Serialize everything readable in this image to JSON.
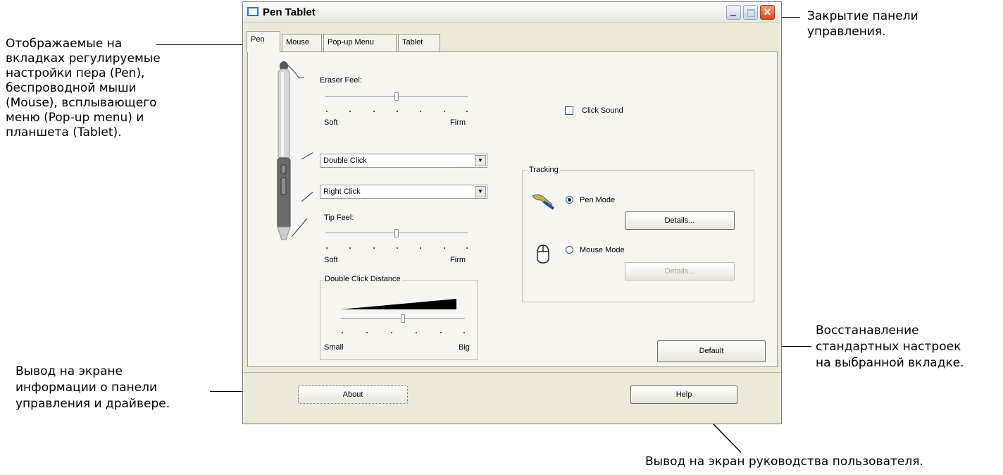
{
  "annotations": {
    "tabs_note": [
      "Отображаемые на",
      "вкладках регулируемые",
      "настройки пера (Pen),",
      "беспроводной мыши",
      "(Mouse), всплывающего",
      "меню (Pop-up menu) и",
      "планшета (Tablet)."
    ],
    "close_note": [
      "Закрытие панели",
      "управления."
    ],
    "default_note": [
      "Восстанавление",
      "стандартных настроек",
      "на выбранной вкладке."
    ],
    "about_note": [
      "Вывод на экране",
      "информации о панели",
      "управления и драйвере."
    ],
    "help_note": "Вывод на экран руководства пользователя."
  },
  "window": {
    "title": "Pen Tablet",
    "close_glyph": "✕"
  },
  "tabs": [
    {
      "label": "Pen",
      "active": true
    },
    {
      "label": "Mouse",
      "active": false
    },
    {
      "label": "Pop-up Menu",
      "active": false
    },
    {
      "label": "Tablet",
      "active": false
    }
  ],
  "pen": {
    "eraser_feel": {
      "label": "Eraser Feel:",
      "min_label": "Soft",
      "max_label": "Firm",
      "level": 0.5
    },
    "upper_button": "Double Click",
    "lower_button": "Right Click",
    "tip_feel": {
      "label": "Tip Feel:",
      "min_label": "Soft",
      "max_label": "Firm",
      "level": 0.5
    },
    "double_click_distance": {
      "label": "Double Click Distance",
      "min_label": "Small",
      "max_label": "Big",
      "level": 0.5
    },
    "click_sound": {
      "label": "Click Sound",
      "checked": false
    },
    "tracking": {
      "label": "Tracking",
      "pen_mode": {
        "label": "Pen Mode",
        "selected": true,
        "details_label": "Details..."
      },
      "mouse_mode": {
        "label": "Mouse Mode",
        "selected": false,
        "details_label": "Details..."
      }
    },
    "default_label": "Default"
  },
  "footer": {
    "about_label": "About",
    "help_label": "Help"
  }
}
